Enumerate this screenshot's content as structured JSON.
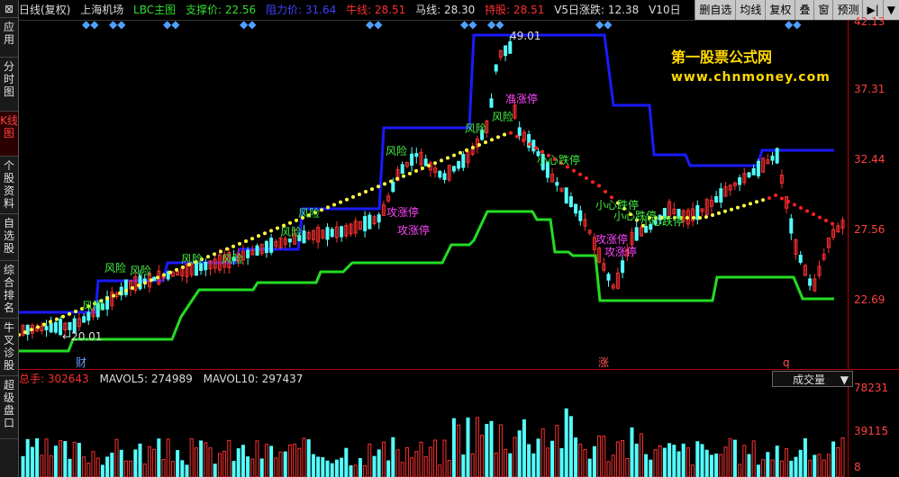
{
  "sidebar": {
    "items": [
      "应用",
      "分时图",
      "K线图",
      "个股资料",
      "自选股",
      "综合排名",
      "牛叉诊股",
      "超级盘口"
    ]
  },
  "header": {
    "period": "日线(复权)",
    "stock": "上海机场",
    "indicator": "LBC主图",
    "support": "支撑价: 22.56",
    "pressure": "阻力价: 31.64",
    "bull": "牛线: 28.51",
    "horse": "马线: 28.30",
    "hold": "持股: 28.51",
    "v5": "V5日涨跌: 12.38",
    "v10": "V10日"
  },
  "toolbar": [
    "删自选",
    "均线",
    "复权",
    "叠",
    "窗",
    "预测"
  ],
  "axis": {
    "price_labels": [
      "42.13",
      "37.31",
      "32.44",
      "27.56",
      "22.69"
    ],
    "volume_labels": [
      "78231",
      "39115",
      "8"
    ]
  },
  "annotations": {
    "high": "49.01",
    "low": "←20.01",
    "risk": "风险",
    "limit_up": "准涨停",
    "attack": "攻涨停",
    "careful": "小心跌停",
    "markers": [
      "财",
      "涨",
      "q"
    ]
  },
  "volume_header": {
    "total": "总手: 302643",
    "ma5": "MAVOL5: 274989",
    "ma10": "MAVOL10: 297437",
    "select": "成交量"
  },
  "brand": {
    "name": "第一股票公式网",
    "url": "www.chnmoney.com"
  },
  "colors": {
    "up": "#ff3030",
    "down": "#54ffff",
    "resistance": "#1a1aff",
    "support": "#22dd22",
    "bull": "#ffff44",
    "bear": "#ff2020"
  }
}
